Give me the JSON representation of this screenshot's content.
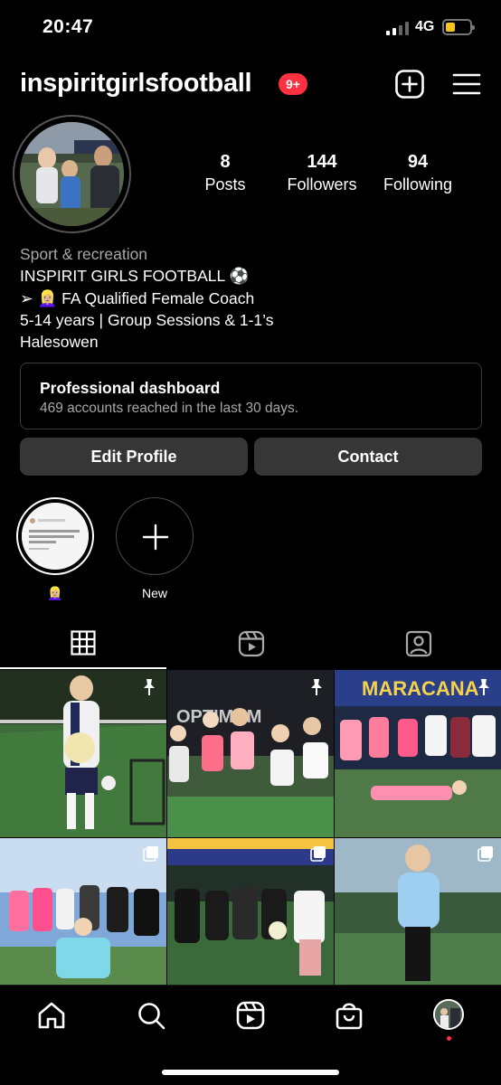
{
  "status_bar": {
    "time": "20:47",
    "network": "4G"
  },
  "header": {
    "username": "inspiritgirlsfootball",
    "notification_count": "9+"
  },
  "profile": {
    "stats": [
      {
        "value": "8",
        "label": "Posts"
      },
      {
        "value": "144",
        "label": "Followers"
      },
      {
        "value": "94",
        "label": "Following"
      }
    ],
    "bio": {
      "category": "Sport & recreation",
      "line1": "INSPIRIT GIRLS FOOTBALL ⚽",
      "line2": "➢ 👱🏼‍♀️ FA Qualified Female Coach",
      "line3": "5-14 years | Group Sessions & 1-1’s",
      "line4": "Halesowen"
    }
  },
  "dashboard": {
    "title": "Professional dashboard",
    "subtitle": "469 accounts reached in the last 30 days."
  },
  "buttons": {
    "edit_profile": "Edit Profile",
    "contact": "Contact"
  },
  "highlights": [
    {
      "label": "👱🏼‍♀️"
    },
    {
      "label": "New"
    }
  ],
  "tabs": [
    {
      "name": "grid-tab",
      "icon": "grid-icon",
      "active": true
    },
    {
      "name": "reels-tab",
      "icon": "reels-icon",
      "active": false
    },
    {
      "name": "tagged-tab",
      "icon": "tagged-icon",
      "active": false
    }
  ],
  "posts": [
    {
      "pinned": true,
      "signage": ""
    },
    {
      "pinned": true,
      "signage": "OPTIMUM"
    },
    {
      "pinned": true,
      "signage": "MARACANA"
    },
    {
      "pinned": false,
      "signage": ""
    },
    {
      "pinned": false,
      "signage": ""
    },
    {
      "pinned": false,
      "signage": ""
    }
  ],
  "bottom_nav": [
    "home-icon",
    "search-icon",
    "reels-icon",
    "shop-icon",
    "profile-avatar"
  ],
  "colors": {
    "background": "#000000",
    "badge": "#ff3040",
    "button": "#363636",
    "battery": "#f5c518"
  }
}
